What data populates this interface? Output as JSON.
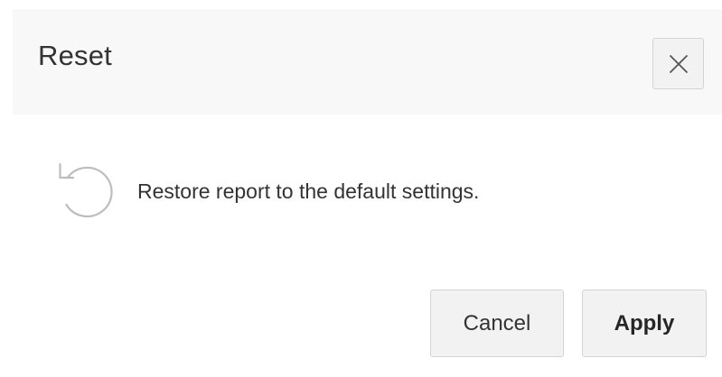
{
  "dialog": {
    "title": "Reset",
    "close_icon": "close-icon",
    "reset_icon": "reset-icon",
    "message": "Restore report to the default settings.",
    "cancel_label": "Cancel",
    "apply_label": "Apply"
  },
  "colors": {
    "header_background": "#f8f8f8",
    "button_background": "#f2f2f2",
    "button_border": "#d4d4d4",
    "text": "#333333",
    "icon": "#bdbdbd"
  }
}
